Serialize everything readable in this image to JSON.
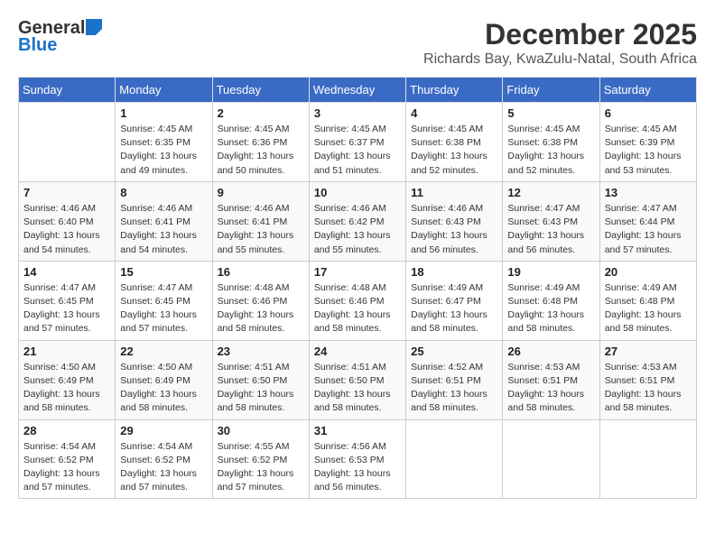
{
  "logo": {
    "general": "General",
    "blue": "Blue"
  },
  "title": "December 2025",
  "location": "Richards Bay, KwaZulu-Natal, South Africa",
  "days": [
    "Sunday",
    "Monday",
    "Tuesday",
    "Wednesday",
    "Thursday",
    "Friday",
    "Saturday"
  ],
  "weeks": [
    [
      {
        "num": "",
        "sunrise": "",
        "sunset": "",
        "daylight": ""
      },
      {
        "num": "1",
        "sunrise": "Sunrise: 4:45 AM",
        "sunset": "Sunset: 6:35 PM",
        "daylight": "Daylight: 13 hours and 49 minutes."
      },
      {
        "num": "2",
        "sunrise": "Sunrise: 4:45 AM",
        "sunset": "Sunset: 6:36 PM",
        "daylight": "Daylight: 13 hours and 50 minutes."
      },
      {
        "num": "3",
        "sunrise": "Sunrise: 4:45 AM",
        "sunset": "Sunset: 6:37 PM",
        "daylight": "Daylight: 13 hours and 51 minutes."
      },
      {
        "num": "4",
        "sunrise": "Sunrise: 4:45 AM",
        "sunset": "Sunset: 6:38 PM",
        "daylight": "Daylight: 13 hours and 52 minutes."
      },
      {
        "num": "5",
        "sunrise": "Sunrise: 4:45 AM",
        "sunset": "Sunset: 6:38 PM",
        "daylight": "Daylight: 13 hours and 52 minutes."
      },
      {
        "num": "6",
        "sunrise": "Sunrise: 4:45 AM",
        "sunset": "Sunset: 6:39 PM",
        "daylight": "Daylight: 13 hours and 53 minutes."
      }
    ],
    [
      {
        "num": "7",
        "sunrise": "Sunrise: 4:46 AM",
        "sunset": "Sunset: 6:40 PM",
        "daylight": "Daylight: 13 hours and 54 minutes."
      },
      {
        "num": "8",
        "sunrise": "Sunrise: 4:46 AM",
        "sunset": "Sunset: 6:41 PM",
        "daylight": "Daylight: 13 hours and 54 minutes."
      },
      {
        "num": "9",
        "sunrise": "Sunrise: 4:46 AM",
        "sunset": "Sunset: 6:41 PM",
        "daylight": "Daylight: 13 hours and 55 minutes."
      },
      {
        "num": "10",
        "sunrise": "Sunrise: 4:46 AM",
        "sunset": "Sunset: 6:42 PM",
        "daylight": "Daylight: 13 hours and 55 minutes."
      },
      {
        "num": "11",
        "sunrise": "Sunrise: 4:46 AM",
        "sunset": "Sunset: 6:43 PM",
        "daylight": "Daylight: 13 hours and 56 minutes."
      },
      {
        "num": "12",
        "sunrise": "Sunrise: 4:47 AM",
        "sunset": "Sunset: 6:43 PM",
        "daylight": "Daylight: 13 hours and 56 minutes."
      },
      {
        "num": "13",
        "sunrise": "Sunrise: 4:47 AM",
        "sunset": "Sunset: 6:44 PM",
        "daylight": "Daylight: 13 hours and 57 minutes."
      }
    ],
    [
      {
        "num": "14",
        "sunrise": "Sunrise: 4:47 AM",
        "sunset": "Sunset: 6:45 PM",
        "daylight": "Daylight: 13 hours and 57 minutes."
      },
      {
        "num": "15",
        "sunrise": "Sunrise: 4:47 AM",
        "sunset": "Sunset: 6:45 PM",
        "daylight": "Daylight: 13 hours and 57 minutes."
      },
      {
        "num": "16",
        "sunrise": "Sunrise: 4:48 AM",
        "sunset": "Sunset: 6:46 PM",
        "daylight": "Daylight: 13 hours and 58 minutes."
      },
      {
        "num": "17",
        "sunrise": "Sunrise: 4:48 AM",
        "sunset": "Sunset: 6:46 PM",
        "daylight": "Daylight: 13 hours and 58 minutes."
      },
      {
        "num": "18",
        "sunrise": "Sunrise: 4:49 AM",
        "sunset": "Sunset: 6:47 PM",
        "daylight": "Daylight: 13 hours and 58 minutes."
      },
      {
        "num": "19",
        "sunrise": "Sunrise: 4:49 AM",
        "sunset": "Sunset: 6:48 PM",
        "daylight": "Daylight: 13 hours and 58 minutes."
      },
      {
        "num": "20",
        "sunrise": "Sunrise: 4:49 AM",
        "sunset": "Sunset: 6:48 PM",
        "daylight": "Daylight: 13 hours and 58 minutes."
      }
    ],
    [
      {
        "num": "21",
        "sunrise": "Sunrise: 4:50 AM",
        "sunset": "Sunset: 6:49 PM",
        "daylight": "Daylight: 13 hours and 58 minutes."
      },
      {
        "num": "22",
        "sunrise": "Sunrise: 4:50 AM",
        "sunset": "Sunset: 6:49 PM",
        "daylight": "Daylight: 13 hours and 58 minutes."
      },
      {
        "num": "23",
        "sunrise": "Sunrise: 4:51 AM",
        "sunset": "Sunset: 6:50 PM",
        "daylight": "Daylight: 13 hours and 58 minutes."
      },
      {
        "num": "24",
        "sunrise": "Sunrise: 4:51 AM",
        "sunset": "Sunset: 6:50 PM",
        "daylight": "Daylight: 13 hours and 58 minutes."
      },
      {
        "num": "25",
        "sunrise": "Sunrise: 4:52 AM",
        "sunset": "Sunset: 6:51 PM",
        "daylight": "Daylight: 13 hours and 58 minutes."
      },
      {
        "num": "26",
        "sunrise": "Sunrise: 4:53 AM",
        "sunset": "Sunset: 6:51 PM",
        "daylight": "Daylight: 13 hours and 58 minutes."
      },
      {
        "num": "27",
        "sunrise": "Sunrise: 4:53 AM",
        "sunset": "Sunset: 6:51 PM",
        "daylight": "Daylight: 13 hours and 58 minutes."
      }
    ],
    [
      {
        "num": "28",
        "sunrise": "Sunrise: 4:54 AM",
        "sunset": "Sunset: 6:52 PM",
        "daylight": "Daylight: 13 hours and 57 minutes."
      },
      {
        "num": "29",
        "sunrise": "Sunrise: 4:54 AM",
        "sunset": "Sunset: 6:52 PM",
        "daylight": "Daylight: 13 hours and 57 minutes."
      },
      {
        "num": "30",
        "sunrise": "Sunrise: 4:55 AM",
        "sunset": "Sunset: 6:52 PM",
        "daylight": "Daylight: 13 hours and 57 minutes."
      },
      {
        "num": "31",
        "sunrise": "Sunrise: 4:56 AM",
        "sunset": "Sunset: 6:53 PM",
        "daylight": "Daylight: 13 hours and 56 minutes."
      },
      {
        "num": "",
        "sunrise": "",
        "sunset": "",
        "daylight": ""
      },
      {
        "num": "",
        "sunrise": "",
        "sunset": "",
        "daylight": ""
      },
      {
        "num": "",
        "sunrise": "",
        "sunset": "",
        "daylight": ""
      }
    ]
  ]
}
